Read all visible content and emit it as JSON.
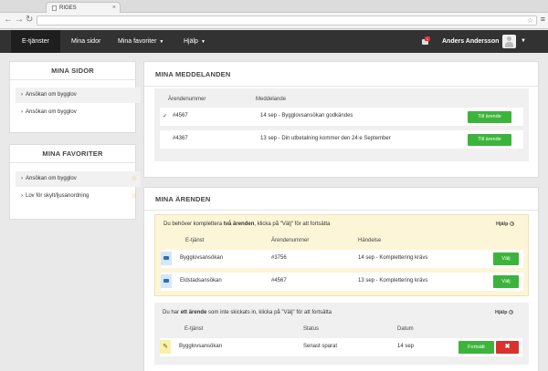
{
  "browser": {
    "tab_title": "RIGES",
    "tab_close": "×",
    "back": "←",
    "forward": "→",
    "reload": "↻",
    "url_value": "",
    "star": "☆",
    "menu": "≡"
  },
  "header": {
    "nav": [
      {
        "label": "E-tjänster"
      },
      {
        "label": "Mina sidor"
      },
      {
        "label": "Mina favoriter"
      },
      {
        "label": "Hjälp"
      }
    ],
    "caret": "▼",
    "notification_count": "1",
    "user_name": "Anders Andersson"
  },
  "sidebar": {
    "mina_sidor": {
      "title": "MINA SIDOR",
      "items": [
        {
          "label": "Ansökan om bygglov"
        },
        {
          "label": "Ansökan om bygglov"
        }
      ]
    },
    "mina_favoriter": {
      "title": "MINA FAVORITER",
      "items": [
        {
          "label": "Ansökan om bygglov"
        },
        {
          "label": "Lov för skylt/ljusanordning"
        }
      ]
    }
  },
  "messages": {
    "title": "MINA MEDDELANDEN",
    "columns": {
      "number": "Ärendenummer",
      "message": "Meddelande"
    },
    "rows": [
      {
        "check": "✓",
        "number": "#4567",
        "message": "14 sep - Bygglovsansökan godkändes",
        "button": "Till ärende"
      },
      {
        "check": "",
        "number": "#4367",
        "message": "13 sep - Din utbetalning kommer den 24:e September",
        "button": "Till ärende"
      }
    ]
  },
  "cases": {
    "title": "MINA ÄRENDEN",
    "complete": {
      "notice_pre": "Du behöver komplettera ",
      "notice_bold": "två ärenden",
      "notice_post": ", klicka på \"Välj\" för att fortsätta",
      "help": "Hjälp",
      "columns": {
        "service": "E-tjänst",
        "number": "Ärendenummer",
        "event": "Händelse"
      },
      "rows": [
        {
          "service": "Bygglovsansökan",
          "number": "#3756",
          "event": "14 sep - Komplettering krävs",
          "button": "Välj"
        },
        {
          "service": "Eldstadsansökan",
          "number": "#4567",
          "event": "13 sep - Komplettering krävs",
          "button": "Välj"
        }
      ]
    },
    "drafts": {
      "notice_pre": "Du har ",
      "notice_bold": "ett ärende",
      "notice_post": " som inte skickats in, klicka på \"Välj\" för att fortsätta",
      "help": "Hjälp",
      "columns": {
        "service": "E-tjänst",
        "status": "Status",
        "date": "Datum"
      },
      "rows": [
        {
          "service": "Bygglovsansökan",
          "status": "Senast sparat",
          "date": "14 sep",
          "continue": "Fortsätt",
          "delete": "✖"
        }
      ]
    }
  },
  "colors": {
    "accent_green": "#3cb43c",
    "danger_red": "#d9312d",
    "header_bg": "#323232",
    "notice_yellow": "#fcf5d7"
  }
}
